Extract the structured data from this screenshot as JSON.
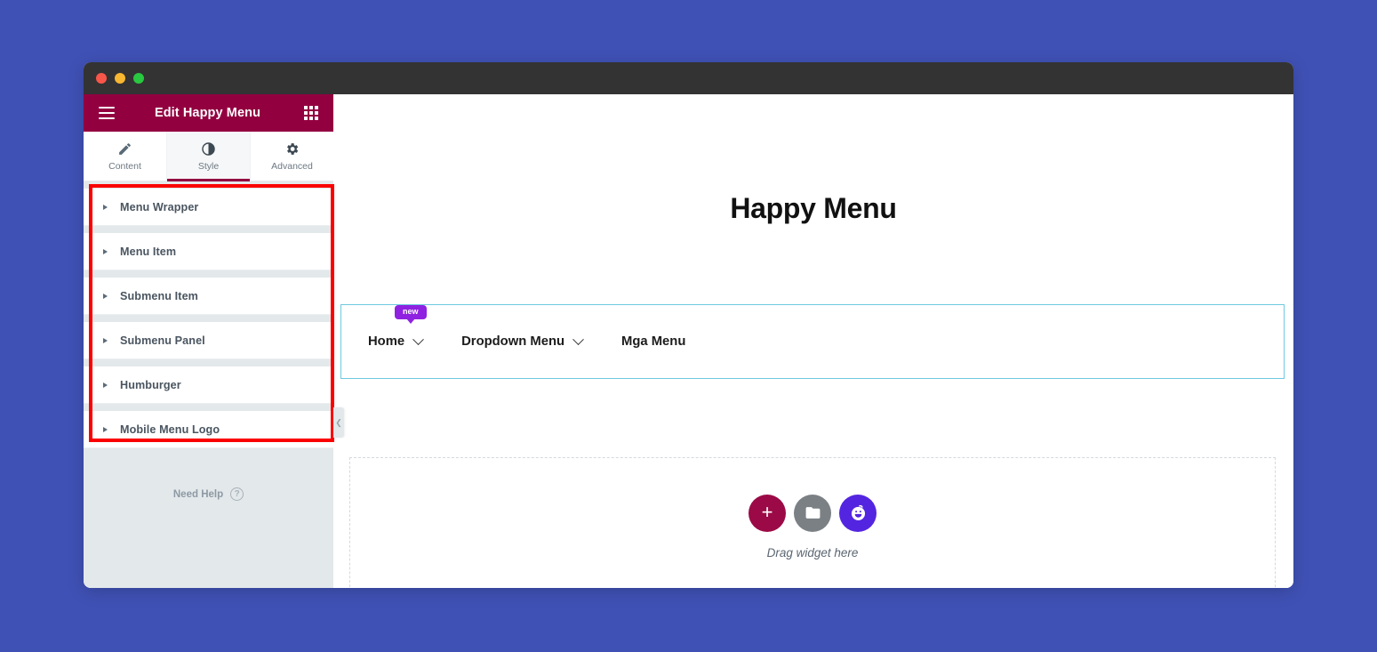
{
  "window": {
    "traffic_lights": [
      "close",
      "minimize",
      "maximize"
    ]
  },
  "panel": {
    "header": {
      "title": "Edit Happy Menu",
      "menu_icon": "hamburger-icon",
      "apps_icon": "grid-icon"
    },
    "tabs": [
      {
        "label": "Content",
        "icon": "pencil-icon",
        "active": false
      },
      {
        "label": "Style",
        "icon": "contrast-icon",
        "active": true
      },
      {
        "label": "Advanced",
        "icon": "gear-icon",
        "active": false
      }
    ],
    "sections": [
      {
        "label": "Menu Wrapper"
      },
      {
        "label": "Menu Item"
      },
      {
        "label": "Submenu Item"
      },
      {
        "label": "Submenu Panel"
      },
      {
        "label": "Humburger"
      },
      {
        "label": "Mobile Menu Logo"
      }
    ],
    "need_help": {
      "label": "Need Help",
      "icon": "question-circle-icon"
    },
    "collapse": {
      "icon": "chevron-left-icon",
      "glyph": "❮"
    }
  },
  "canvas": {
    "page_title": "Happy Menu",
    "menu": {
      "items": [
        {
          "label": "Home",
          "has_dropdown": true,
          "badge": "new"
        },
        {
          "label": "Dropdown Menu",
          "has_dropdown": true,
          "badge": null
        },
        {
          "label": "Mga Menu",
          "has_dropdown": false,
          "badge": null
        }
      ]
    },
    "drop_area": {
      "text": "Drag widget here",
      "buttons": [
        {
          "name": "add-widget-button",
          "icon": "plus-icon",
          "glyph": "+"
        },
        {
          "name": "add-template-button",
          "icon": "folder-icon",
          "glyph": ""
        },
        {
          "name": "happy-addons-button",
          "icon": "happy-face-icon",
          "glyph": ""
        }
      ]
    }
  },
  "colors": {
    "desktop_background": "#3f51b5",
    "panel_header": "#930040",
    "panel_background": "#e3e8ea",
    "accent": "#930040",
    "annotation_red": "#fb0000",
    "badge_purple": "#8f22e0",
    "selection_blue": "#6ec9e0",
    "happy_button": "#5425e0"
  }
}
